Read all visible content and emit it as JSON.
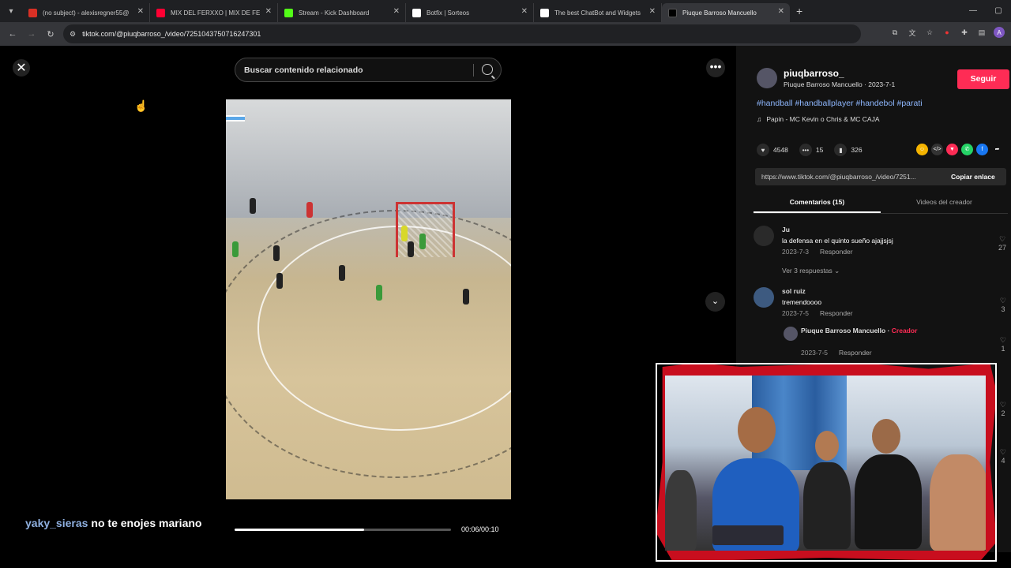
{
  "browser": {
    "tabs": [
      {
        "title": "(no subject) - alexisregner55@",
        "favicon_color": "#d93025"
      },
      {
        "title": "MIX DEL FERXXO | MIX DE FEID",
        "favicon_color": "#ff0033"
      },
      {
        "title": "Stream - Kick Dashboard",
        "favicon_color": "#53fc18"
      },
      {
        "title": "Botfix | Sorteos",
        "favicon_color": "#ffffff"
      },
      {
        "title": "The best ChatBot and Widgets",
        "favicon_color": "#ffffff"
      },
      {
        "title": "Piuque Barroso Mancuello",
        "favicon_color": "#000000",
        "active": true
      }
    ],
    "new_tab": "+",
    "url": "tiktok.com/@piuqbarroso_/video/7251043750716247301"
  },
  "search": {
    "placeholder": "Buscar contenido relacionado"
  },
  "video": {
    "progress": 0.6,
    "timecode": "00:06/00:10"
  },
  "chat": {
    "user": "yaky_sieras",
    "message": "no te enojes mariano"
  },
  "author": {
    "username": "piuqbarroso_",
    "subtitle": "Piuque Barroso Mancuello · 2023-7-1",
    "follow_label": "Seguir"
  },
  "description": {
    "tags": "#handball #handballplayer #handebol #parati",
    "music": "Papin - MC Kevin o Chris & MC CAJA"
  },
  "stats": {
    "likes": "4548",
    "comments": "15",
    "saves": "326"
  },
  "link": {
    "url": "https://www.tiktok.com/@piuqbarroso_/video/7251...",
    "copy_label": "Copiar enlace"
  },
  "panel_tabs": {
    "comments": "Comentarios (15)",
    "creator_videos": "Videos del creador"
  },
  "comments": [
    {
      "user": "Ju",
      "text": "la defensa en el quinto sueño ajajjsjsj",
      "date": "2023-7-3",
      "reply": "Responder",
      "likes": "27"
    },
    {
      "user": "sol ruiz",
      "text": "tremendoooo",
      "date": "2023-7-5",
      "reply": "Responder",
      "likes": "3"
    },
    {
      "user": "Piuque Barroso Mancuello",
      "badge": "Creador",
      "date": "2023-7-5",
      "reply": "Responder",
      "likes": "1"
    }
  ],
  "view_replies": "Ver 3 respuestas",
  "side_likes": [
    "2",
    "4"
  ]
}
